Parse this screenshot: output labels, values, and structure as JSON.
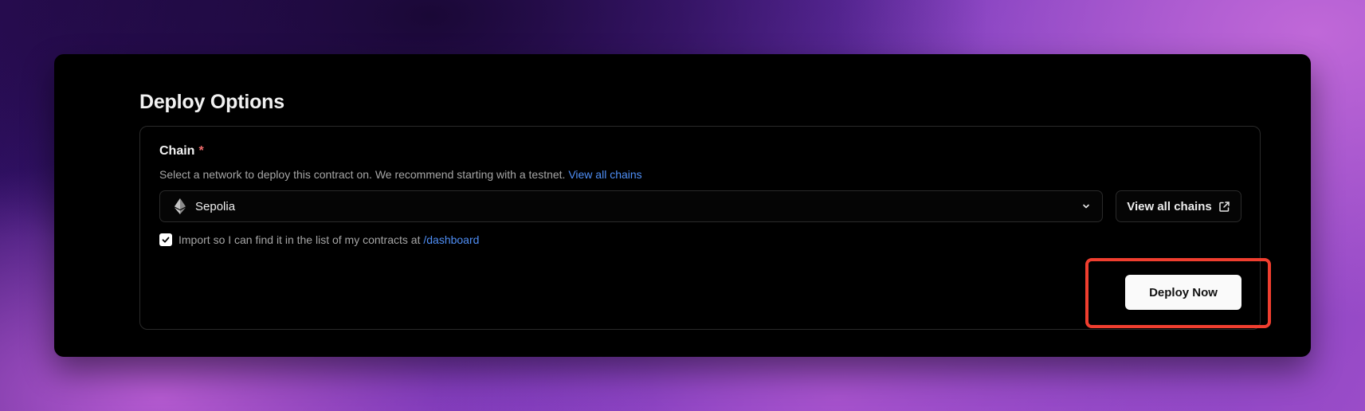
{
  "section": {
    "title": "Deploy Options"
  },
  "chain": {
    "label": "Chain",
    "required_marker": "*",
    "helper_text": "Select a network to deploy this contract on. We recommend starting with a testnet.",
    "helper_link": "View all chains",
    "selected": "Sepolia",
    "selected_icon": "ethereum-icon",
    "view_all_button": "View all chains",
    "view_all_icon": "external-link-icon"
  },
  "import": {
    "checked": true,
    "text": "Import so I can find it in the list of my contracts at",
    "link": "/dashboard"
  },
  "actions": {
    "deploy_label": "Deploy Now"
  },
  "colors": {
    "accent_link": "#4f8ff7",
    "required": "#f26d6d",
    "highlight": "#f03e2f"
  }
}
